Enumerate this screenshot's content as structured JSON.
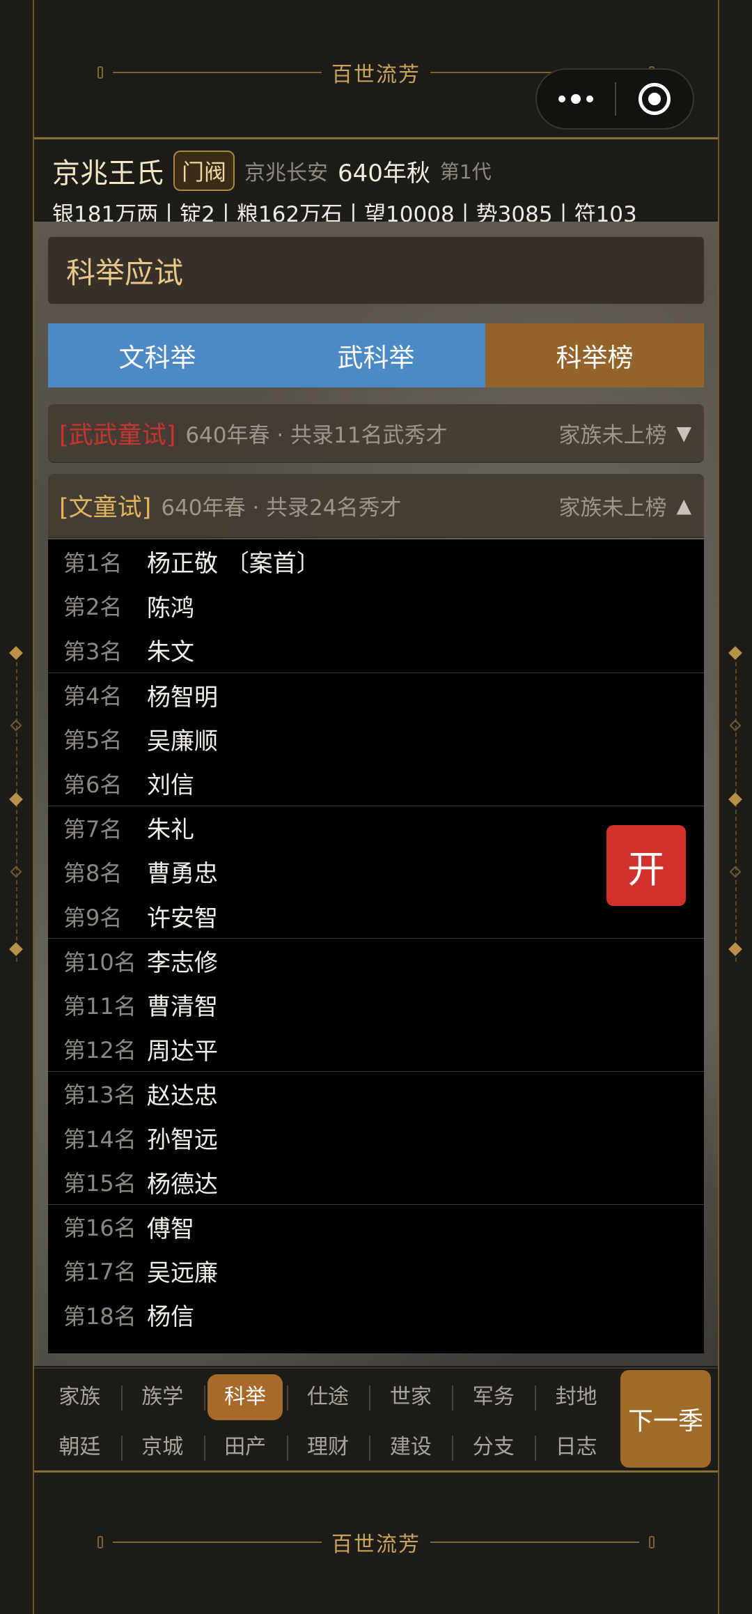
{
  "banner": {
    "title": "百世流芳"
  },
  "family": {
    "name": "京兆王氏",
    "badge": "门阀",
    "place": "京兆长安",
    "year": "640年秋",
    "generation": "第1代",
    "stats": "银181万两丨锭2丨粮162万石丨望10008丨势3085丨符103"
  },
  "panel": {
    "title": "科举应试"
  },
  "tabs": [
    {
      "label": "文科举",
      "active": false
    },
    {
      "label": "武科举",
      "active": false
    },
    {
      "label": "科举榜",
      "active": true
    }
  ],
  "exams": [
    {
      "tag": "[武武童试]",
      "info": "640年春 · 共录11名武秀才",
      "status": "家族未上榜",
      "arrow": "▼"
    },
    {
      "tag": "[文童试]",
      "info": "640年春 · 共录24名秀才",
      "status": "家族未上榜",
      "arrow": "▲"
    }
  ],
  "ranking": [
    {
      "rank": "第1名",
      "name": "杨正敬 〔案首〕"
    },
    {
      "rank": "第2名",
      "name": "陈鸿"
    },
    {
      "rank": "第3名",
      "name": "朱文"
    },
    {
      "rank": "第4名",
      "name": "杨智明"
    },
    {
      "rank": "第5名",
      "name": "吴廉顺"
    },
    {
      "rank": "第6名",
      "name": "刘信"
    },
    {
      "rank": "第7名",
      "name": "朱礼"
    },
    {
      "rank": "第8名",
      "name": "曹勇忠"
    },
    {
      "rank": "第9名",
      "name": "许安智"
    },
    {
      "rank": "第10名",
      "name": "李志修"
    },
    {
      "rank": "第11名",
      "name": "曹清智"
    },
    {
      "rank": "第12名",
      "name": "周达平"
    },
    {
      "rank": "第13名",
      "name": "赵达忠"
    },
    {
      "rank": "第14名",
      "name": "孙智远"
    },
    {
      "rank": "第15名",
      "name": "杨德达"
    },
    {
      "rank": "第16名",
      "name": "傅智"
    },
    {
      "rank": "第17名",
      "name": "吴远廉"
    },
    {
      "rank": "第18名",
      "name": "杨信"
    }
  ],
  "open_button": "开",
  "nav": {
    "row1": [
      "家族",
      "族学",
      "科举",
      "仕途",
      "世家",
      "军务",
      "封地"
    ],
    "row2": [
      "朝廷",
      "京城",
      "田产",
      "理财",
      "建设",
      "分支",
      "日志"
    ],
    "active": "科举",
    "next": "下一季"
  }
}
